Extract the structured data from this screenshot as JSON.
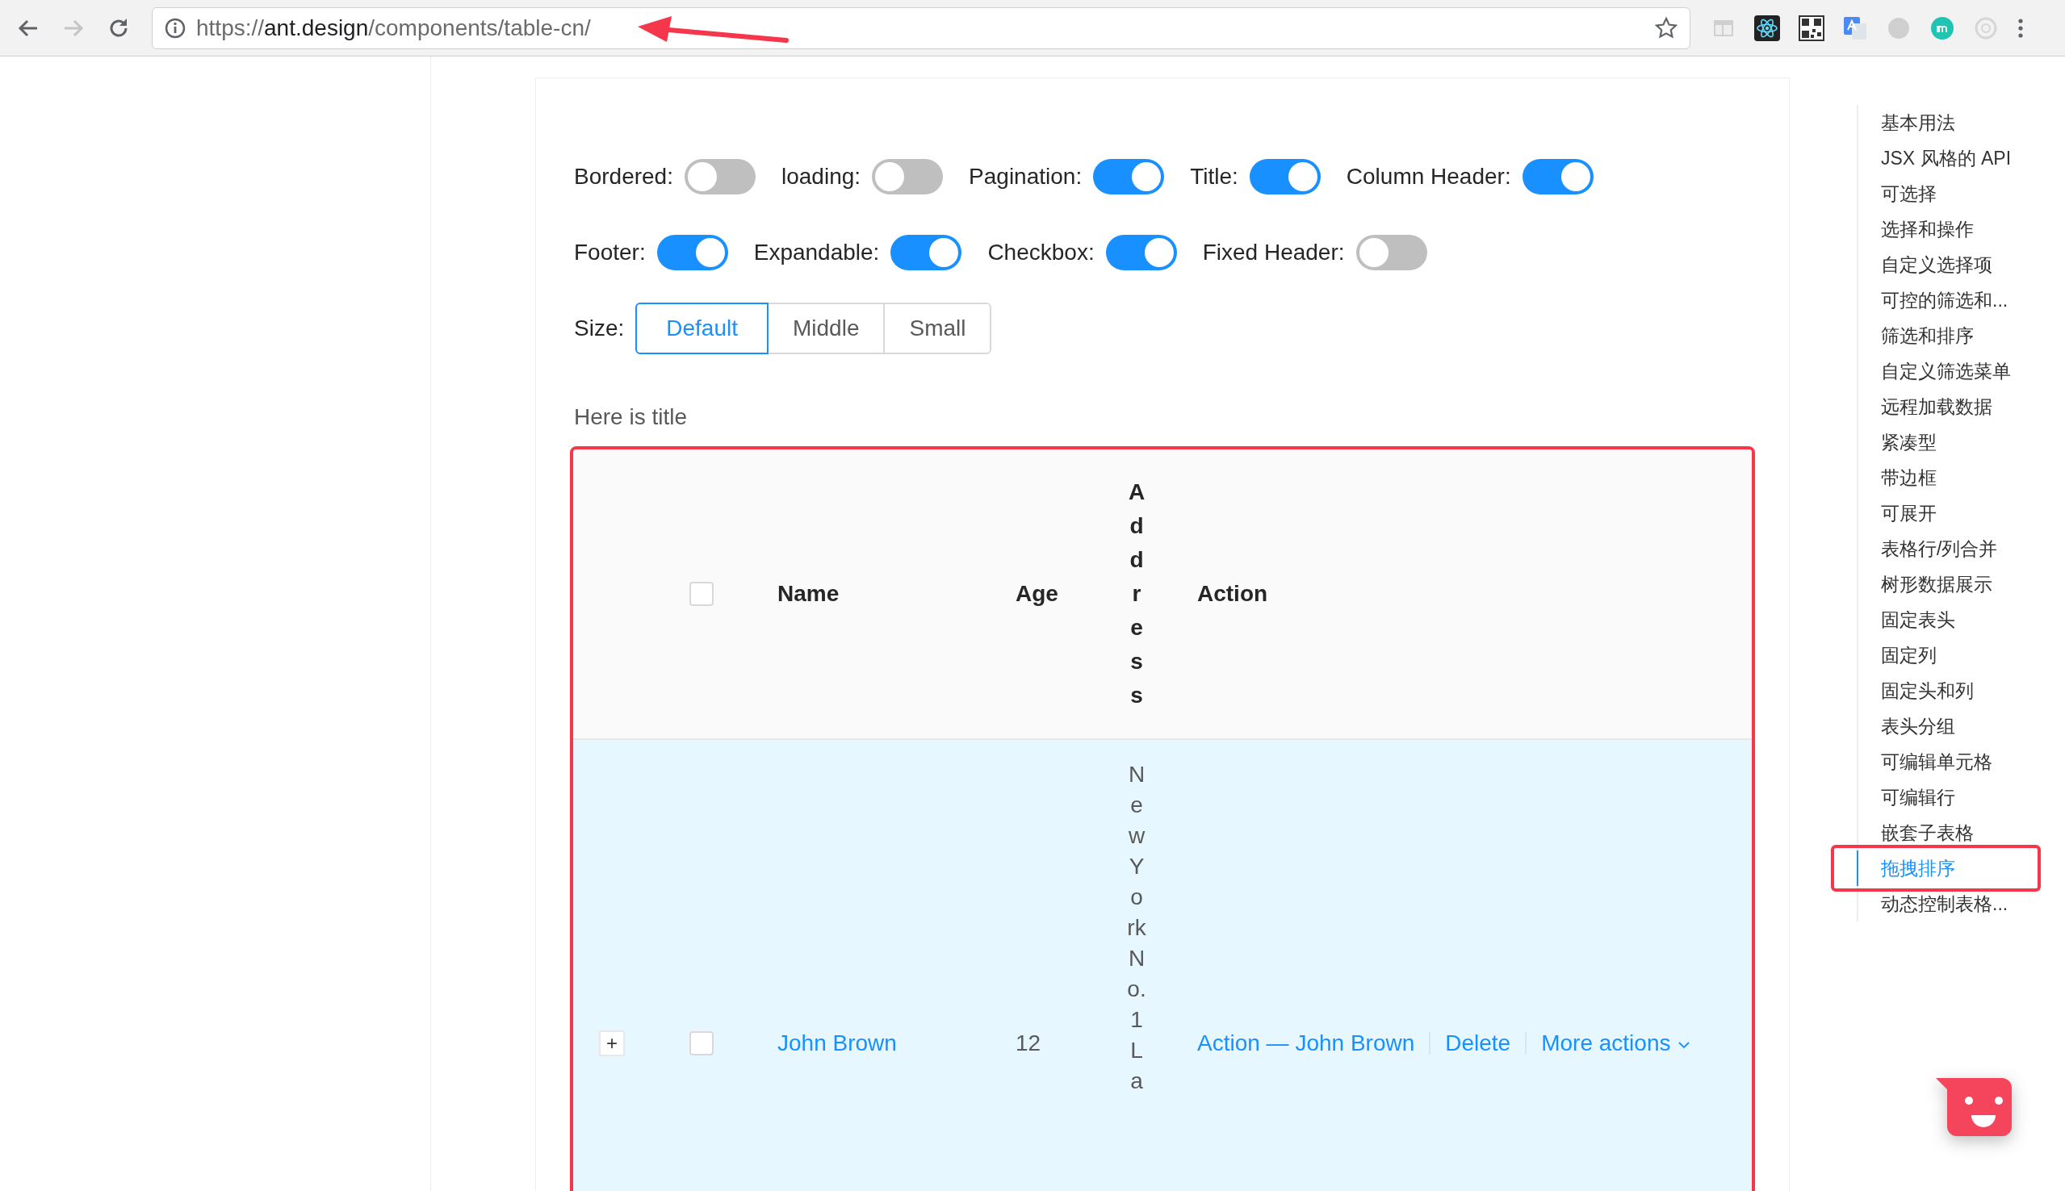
{
  "browser": {
    "url": {
      "scheme": "https://",
      "host": "ant.design",
      "path": "/components/table-cn/"
    }
  },
  "controls": {
    "toggles": [
      {
        "label": "Bordered:",
        "on": false
      },
      {
        "label": "loading:",
        "on": false
      },
      {
        "label": "Pagination:",
        "on": true
      },
      {
        "label": "Title:",
        "on": true
      },
      {
        "label": "Column Header:",
        "on": true
      },
      {
        "label": "Footer:",
        "on": true
      },
      {
        "label": "Expandable:",
        "on": true
      },
      {
        "label": "Checkbox:",
        "on": true
      },
      {
        "label": "Fixed Header:",
        "on": false
      }
    ],
    "size": {
      "label": "Size:",
      "options": [
        {
          "label": "Default",
          "selected": true
        },
        {
          "label": "Middle",
          "selected": false
        },
        {
          "label": "Small",
          "selected": false
        }
      ]
    }
  },
  "table": {
    "title": "Here is title",
    "highlighted": true,
    "header_checked": false,
    "columns": [
      "Name",
      "Age",
      "Address",
      "Action"
    ],
    "rows": [
      {
        "expand_icon": "+",
        "checked": false,
        "name": "John Brown",
        "age": "12",
        "address": "New York No. 1 La",
        "actions": [
          "Action — John Brown",
          "Delete"
        ],
        "more": "More actions"
      }
    ]
  },
  "toc": {
    "items": [
      {
        "label": "基本用法",
        "selected": false,
        "highlighted": false
      },
      {
        "label": "JSX 风格的 API",
        "selected": false,
        "highlighted": false
      },
      {
        "label": "可选择",
        "selected": false,
        "highlighted": false
      },
      {
        "label": "选择和操作",
        "selected": false,
        "highlighted": false
      },
      {
        "label": "自定义选择项",
        "selected": false,
        "highlighted": false
      },
      {
        "label": "可控的筛选和...",
        "selected": false,
        "highlighted": false
      },
      {
        "label": "筛选和排序",
        "selected": false,
        "highlighted": false
      },
      {
        "label": "自定义筛选菜单",
        "selected": false,
        "highlighted": false
      },
      {
        "label": "远程加载数据",
        "selected": false,
        "highlighted": false
      },
      {
        "label": "紧凑型",
        "selected": false,
        "highlighted": false
      },
      {
        "label": "带边框",
        "selected": false,
        "highlighted": false
      },
      {
        "label": "可展开",
        "selected": false,
        "highlighted": false
      },
      {
        "label": "表格行/列合并",
        "selected": false,
        "highlighted": false
      },
      {
        "label": "树形数据展示",
        "selected": false,
        "highlighted": false
      },
      {
        "label": "固定表头",
        "selected": false,
        "highlighted": false
      },
      {
        "label": "固定列",
        "selected": false,
        "highlighted": false
      },
      {
        "label": "固定头和列",
        "selected": false,
        "highlighted": false
      },
      {
        "label": "表头分组",
        "selected": false,
        "highlighted": false
      },
      {
        "label": "可编辑单元格",
        "selected": false,
        "highlighted": false
      },
      {
        "label": "可编辑行",
        "selected": false,
        "highlighted": false
      },
      {
        "label": "嵌套子表格",
        "selected": false,
        "highlighted": false
      },
      {
        "label": "拖拽排序",
        "selected": true,
        "highlighted": true
      },
      {
        "label": "动态控制表格...",
        "selected": false,
        "highlighted": false
      }
    ]
  }
}
